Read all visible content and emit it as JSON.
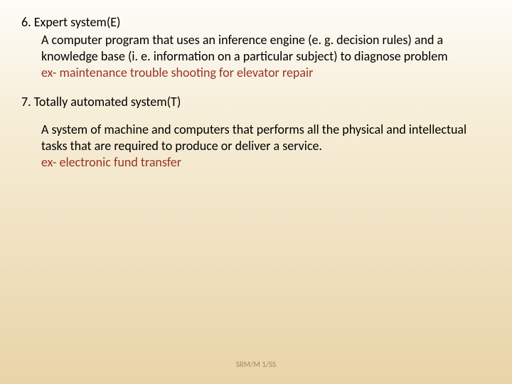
{
  "sections": [
    {
      "heading": "6. Expert system(E)",
      "body": "A computer program that uses an inference engine (e. g. decision rules) and a knowledge base (i. e. information on a particular subject) to diagnose problem",
      "example": "ex- maintenance trouble shooting for  elevator repair"
    },
    {
      "heading": "7. Totally automated system(T)",
      "body": "A system of machine and computers that performs all the physical and intellectual tasks that are required to produce or deliver a service.",
      "example": "ex- electronic fund transfer"
    }
  ],
  "footer": "SRM/M 1/SS"
}
